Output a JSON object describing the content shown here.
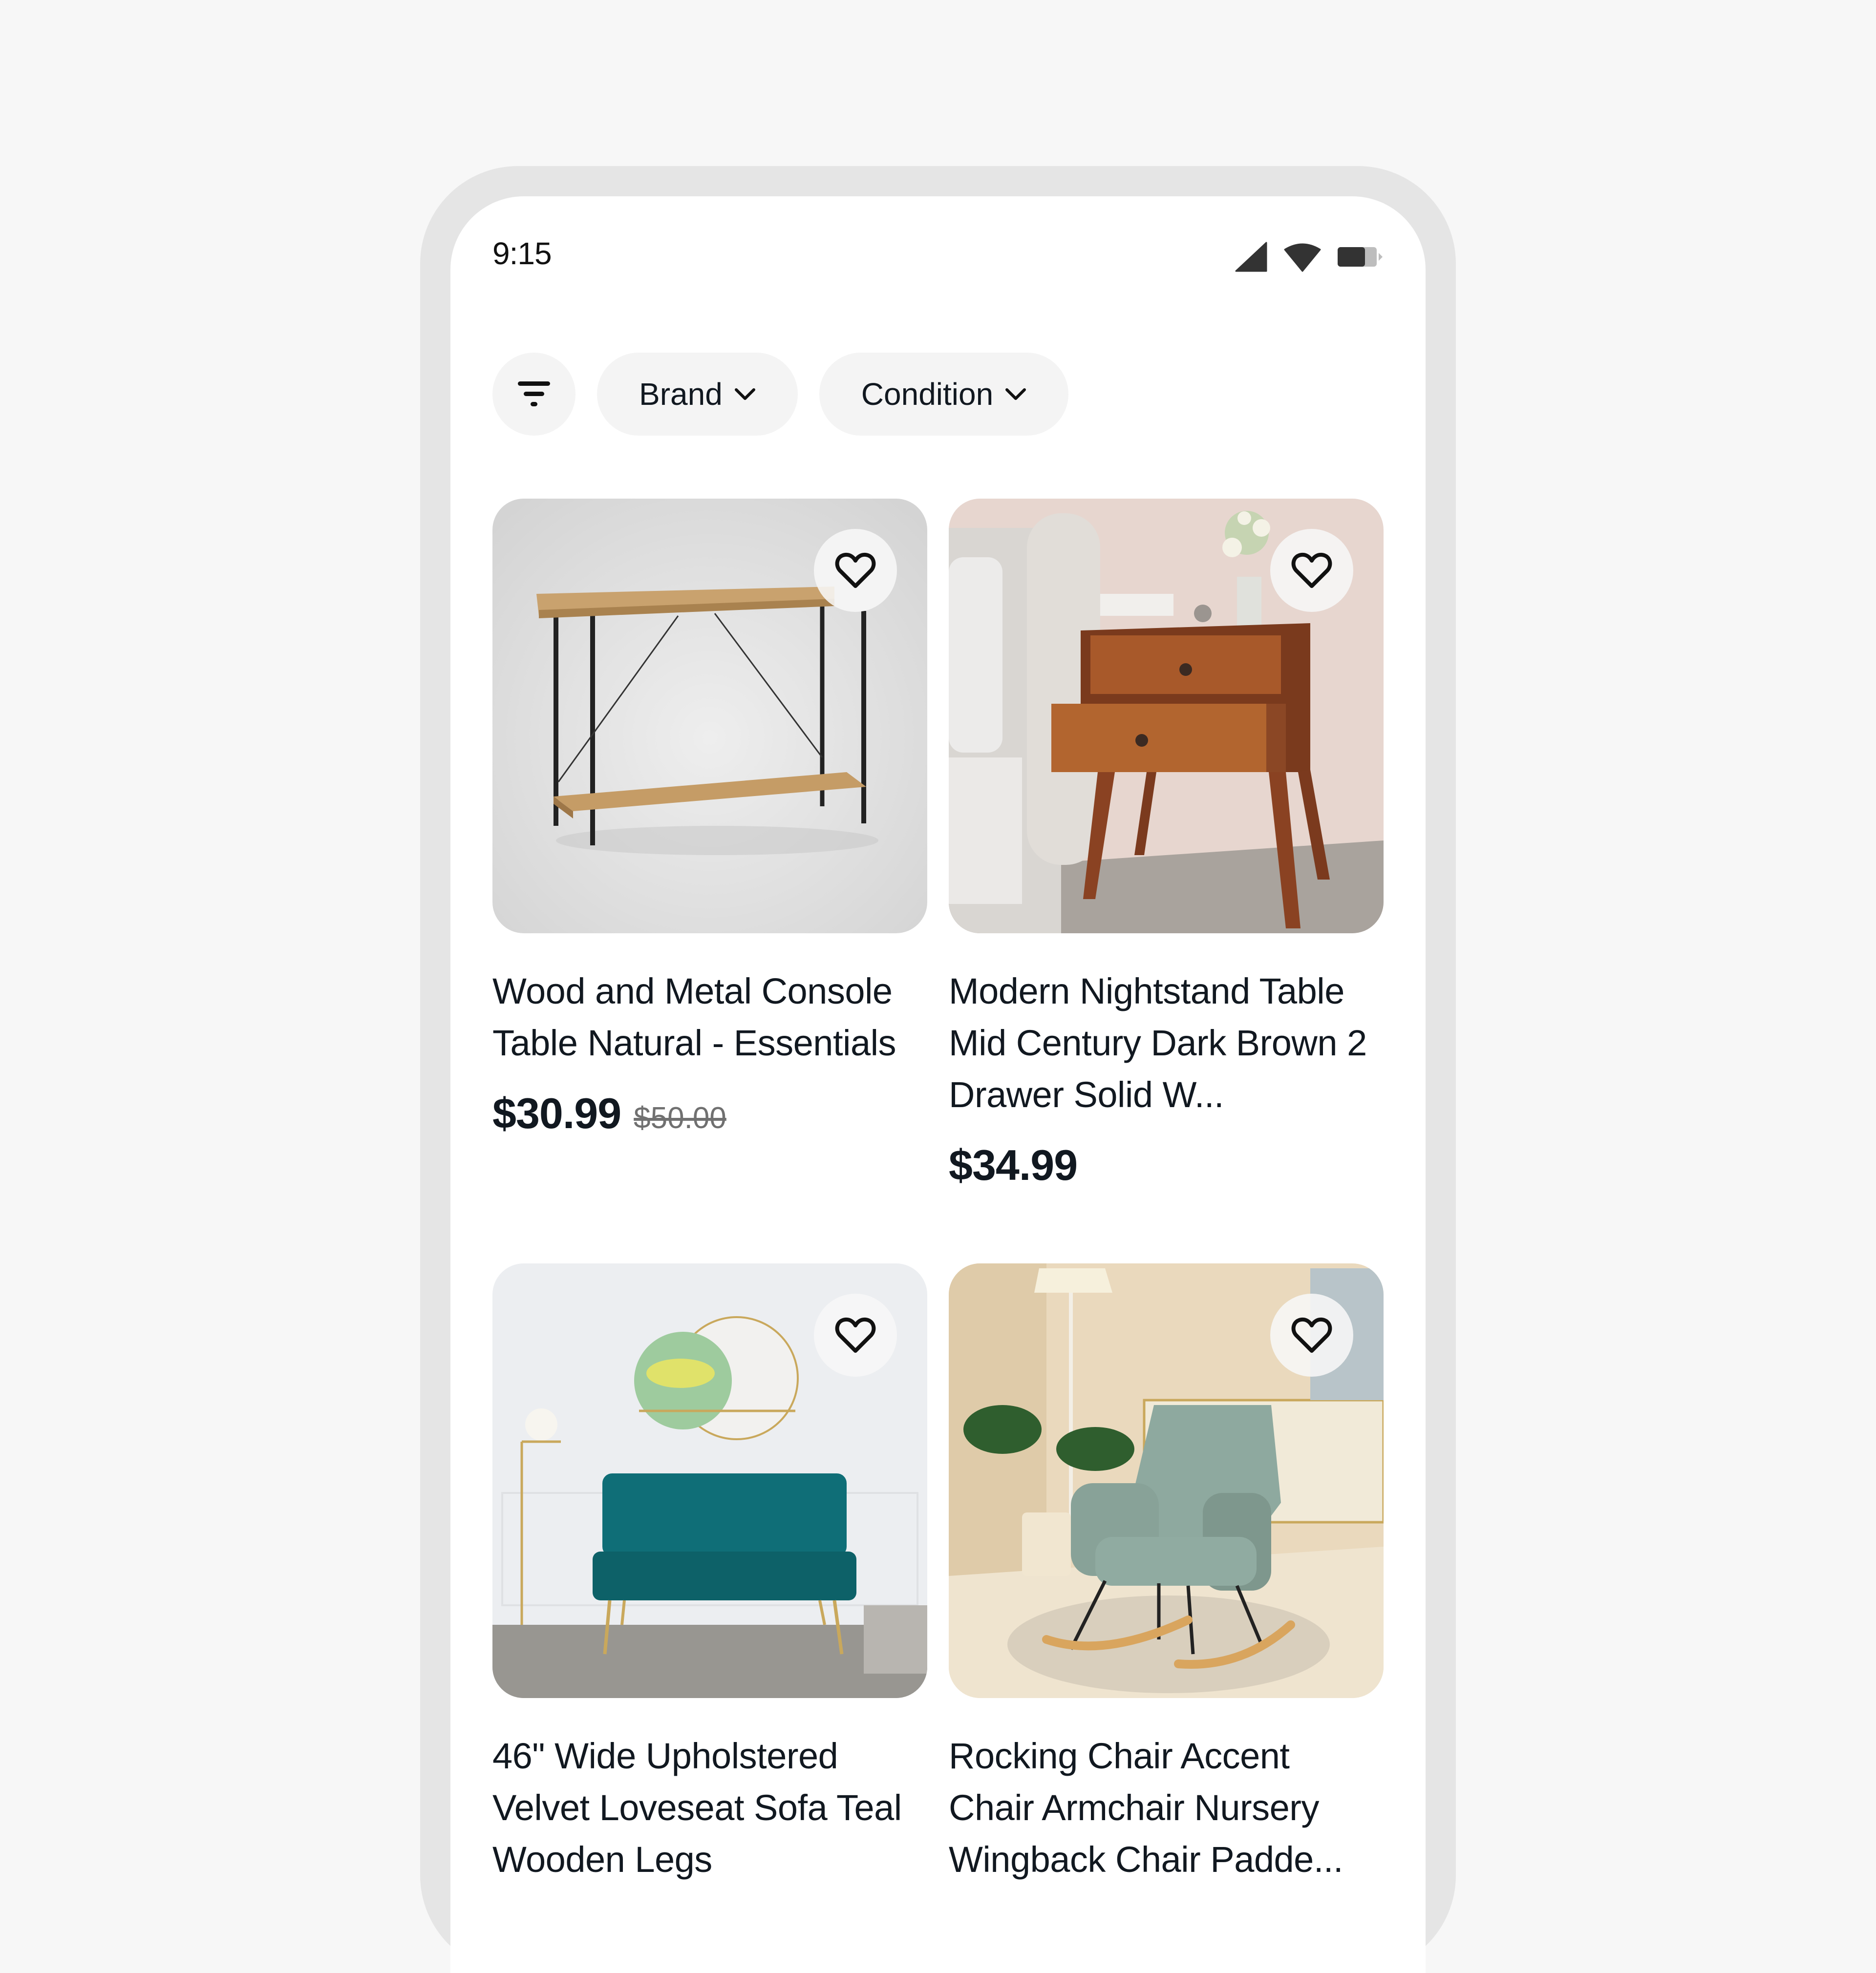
{
  "status_bar": {
    "time": "9:15",
    "icons": [
      "cellular-signal-icon",
      "wifi-icon",
      "battery-icon"
    ],
    "battery_level_percent": 70
  },
  "filters": {
    "filter_icon": "filter-icon",
    "chips": [
      {
        "label": "Brand",
        "icon": "chevron-down-icon"
      },
      {
        "label": "Condition",
        "icon": "chevron-down-icon"
      }
    ]
  },
  "products": [
    {
      "title": "Wood and Metal Console Table Natural - Essentials",
      "price": "$30.99",
      "original_price": "$50.00",
      "image": "console-table-image",
      "favorite_icon": "heart-outline-icon"
    },
    {
      "title": "Modern Nightstand Table Mid Century Dark Brown 2 Drawer Solid W...",
      "price": "$34.99",
      "original_price": null,
      "image": "nightstand-image",
      "favorite_icon": "heart-outline-icon"
    },
    {
      "title": "46\" Wide Upholstered Velvet Loveseat Sofa Teal Wooden Legs",
      "price": null,
      "original_price": null,
      "image": "loveseat-image",
      "favorite_icon": "heart-outline-icon"
    },
    {
      "title": "Rocking Chair Accent Chair Armchair Nursery Wingback Chair Padde...",
      "price": null,
      "original_price": null,
      "image": "rocking-chair-image",
      "favorite_icon": "heart-outline-icon"
    }
  ],
  "colors": {
    "background": "#f7f7f7",
    "frame": "#e5e5e5",
    "chip_bg": "#f4f4f4",
    "text": "#111820",
    "strike_price": "#707070"
  }
}
